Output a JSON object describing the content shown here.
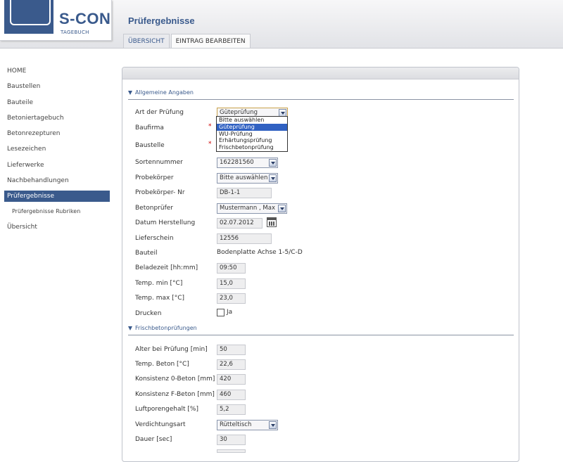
{
  "brand": {
    "name": "S-CON",
    "sub": "TAGEBUCH",
    "color": "#3a5a8c"
  },
  "header": {
    "title": "Prüfergebnisse"
  },
  "tabs": [
    {
      "label": "ÜBERSICHT",
      "active": false
    },
    {
      "label": "EINTRAG BEARBEITEN",
      "active": true
    }
  ],
  "sidebar": {
    "items": [
      {
        "label": "HOME"
      },
      {
        "label": "Baustellen"
      },
      {
        "label": "Bauteile"
      },
      {
        "label": "Betoniertagebuch"
      },
      {
        "label": "Betonrezepturen"
      },
      {
        "label": "Lesezeichen"
      },
      {
        "label": "Lieferwerke"
      },
      {
        "label": "Nachbehandlungen"
      },
      {
        "label": "Prüfergebnisse",
        "active": true
      },
      {
        "label": "Prüfergebnisse Rubriken",
        "sub": true
      },
      {
        "label": "Übersicht"
      }
    ]
  },
  "sections": {
    "general": "Allgemeine Angaben",
    "fresh": "Frischbetonprüfungen"
  },
  "form": {
    "art": {
      "label": "Art der Prüfung",
      "value": "Güteprüfung"
    },
    "baufirma": {
      "label": "Baufirma",
      "required": "*"
    },
    "baustelle": {
      "label": "Baustelle",
      "required": "*"
    },
    "sortennummer": {
      "label": "Sortennummer",
      "value": "162281560"
    },
    "probekoerper": {
      "label": "Probekörper",
      "value": "Bitte auswählen"
    },
    "probekoerper_nr": {
      "label": "Probekörper- Nr",
      "value": "DB-1-1"
    },
    "betonpruefer": {
      "label": "Betonprüfer",
      "value": "Mustermann , Max"
    },
    "datum": {
      "label": "Datum Herstellung",
      "value": "02.07.2012"
    },
    "lieferschein": {
      "label": "Lieferschein",
      "value": "12556"
    },
    "bauteil": {
      "label": "Bauteil",
      "value": "Bodenplatte Achse 1-5/C-D"
    },
    "beladezeit": {
      "label": "Beladezeit [hh:mm]",
      "value": "09:50"
    },
    "temp_min": {
      "label": "Temp. min [°C]",
      "value": "15,0"
    },
    "temp_max": {
      "label": "Temp. max [°C]",
      "value": "23,0"
    },
    "drucken": {
      "label": "Drucken",
      "option": "Ja"
    },
    "alter": {
      "label": "Alter bei Prüfung [min]",
      "value": "50"
    },
    "temp_beton": {
      "label": "Temp. Beton [°C]",
      "value": "22,6"
    },
    "konsistenz_o": {
      "label": "Konsistenz 0-Beton [mm]",
      "value": "420"
    },
    "konsistenz_f": {
      "label": "Konsistenz F-Beton [mm]",
      "value": "460"
    },
    "luftporen": {
      "label": "Luftporengehalt [%]",
      "value": "5,2"
    },
    "verdichtungsart": {
      "label": "Verdichtungsart",
      "value": "Rütteltisch"
    },
    "dauer": {
      "label": "Dauer [sec]",
      "value": "30"
    }
  },
  "dropdown_options": [
    "Bitte auswählen",
    "Güteprüfung",
    "WU-Prüfung",
    "Erhärtungsprüfung",
    "Frischbetonprüfung"
  ],
  "dropdown_selected": "Güteprüfung"
}
